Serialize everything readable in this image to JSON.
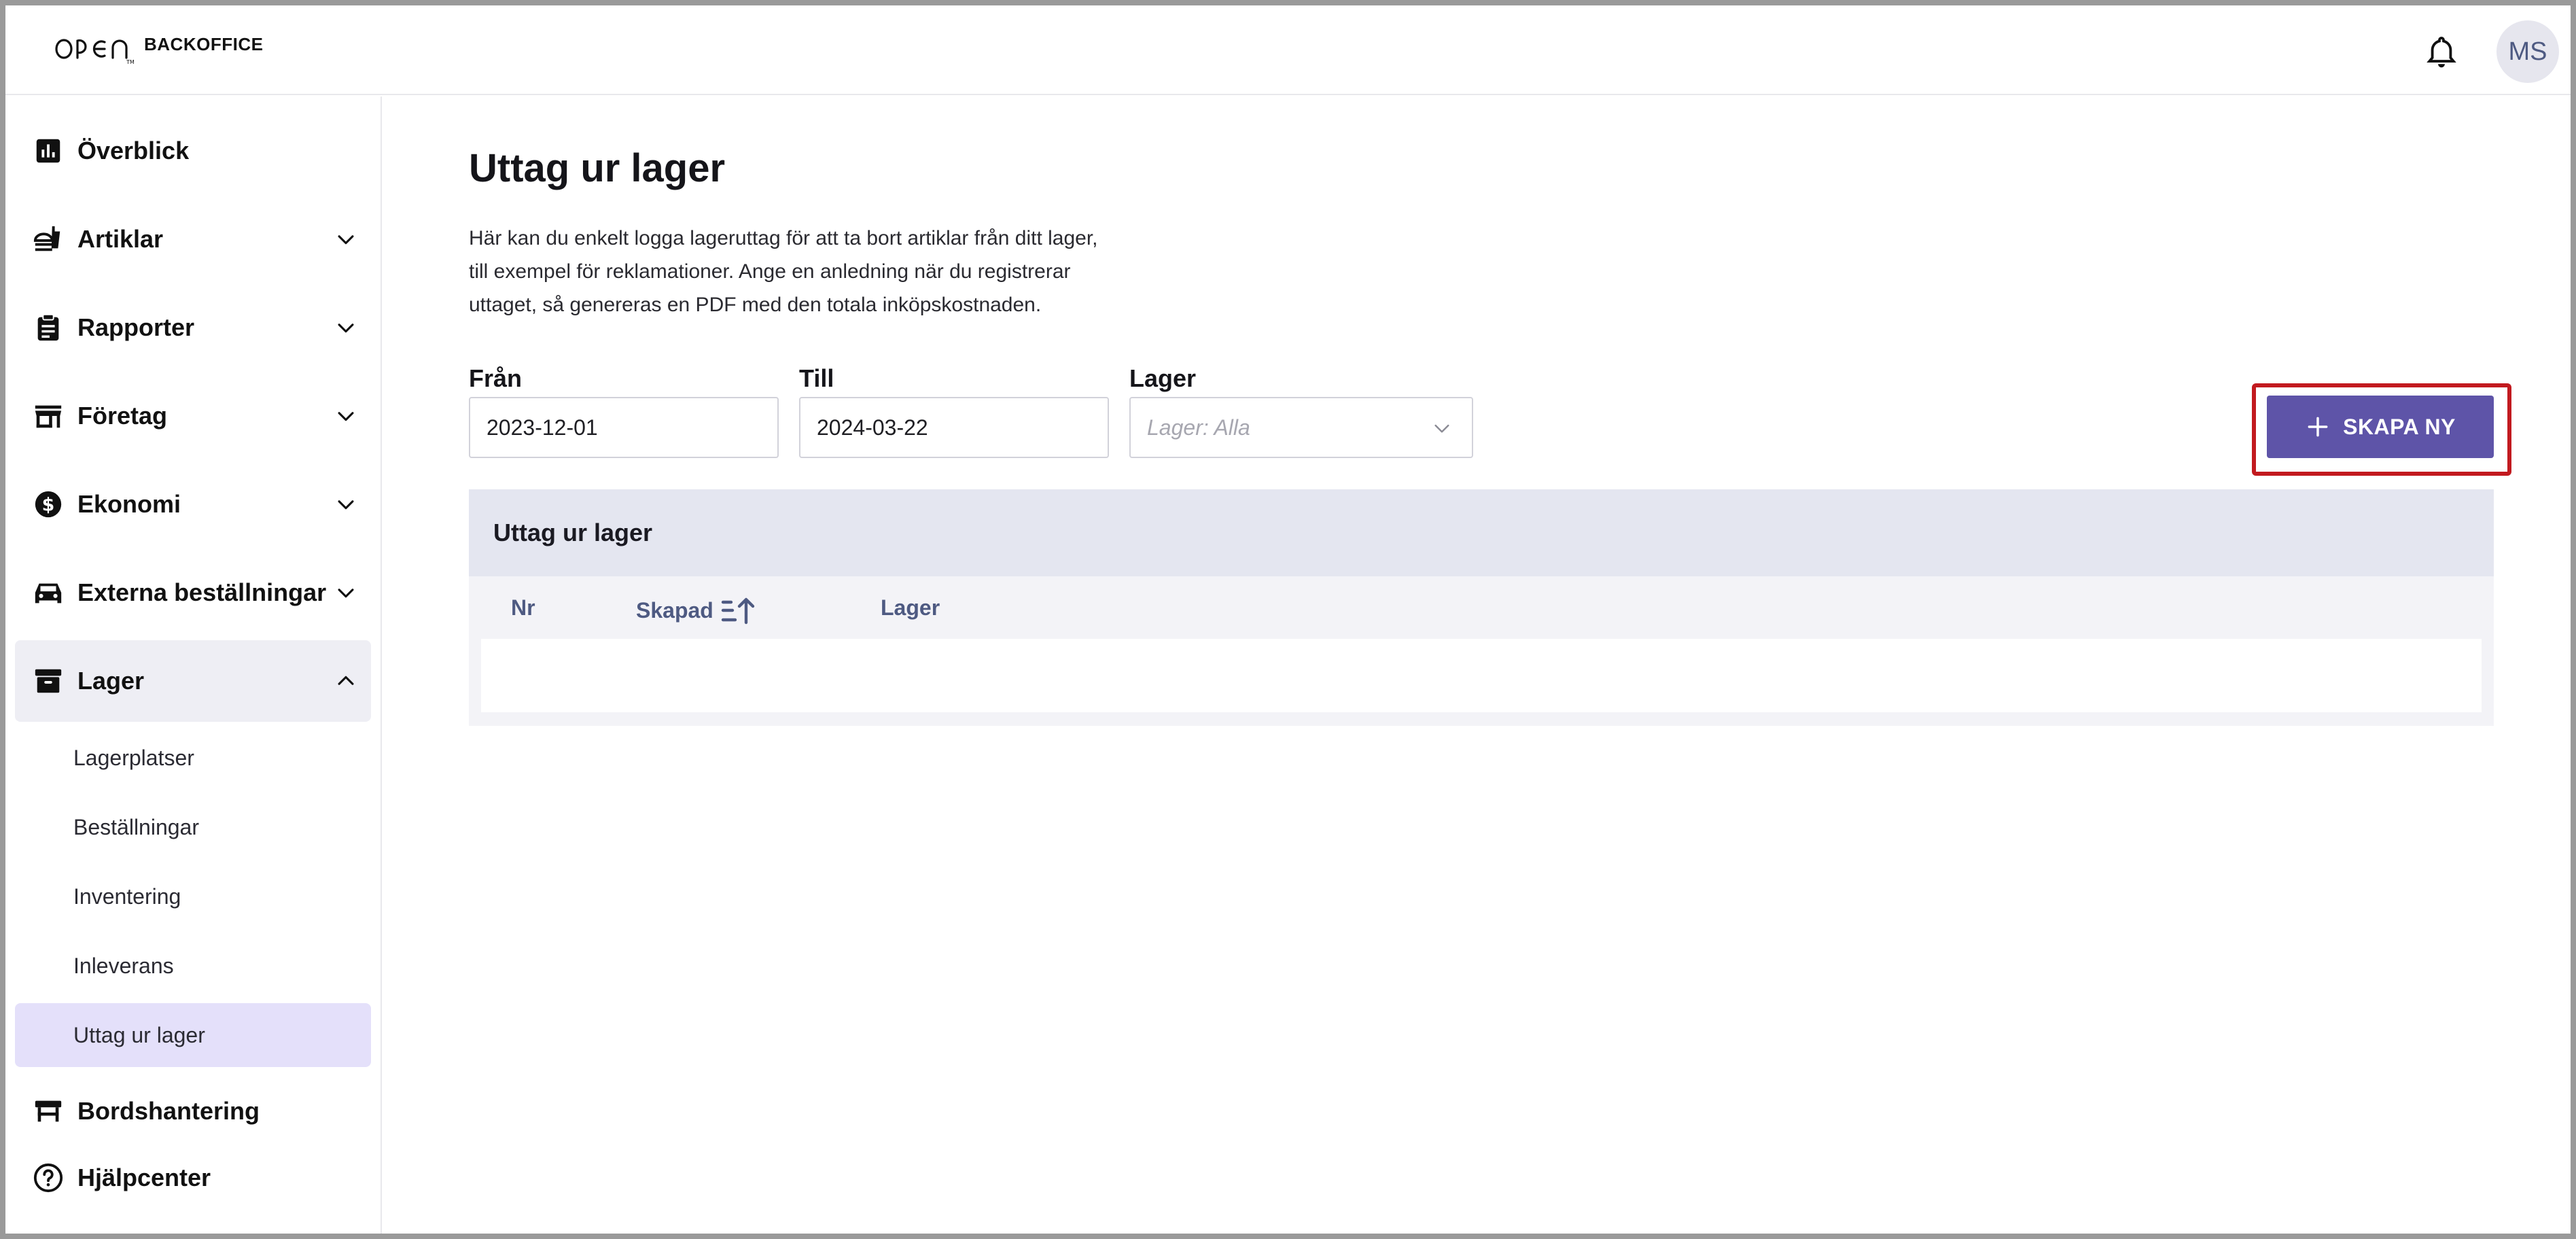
{
  "header": {
    "logo_mark": "OPEN",
    "logo_text": "BACKOFFICE",
    "avatar_initials": "MS"
  },
  "sidebar": {
    "items": [
      {
        "label": "Överblick",
        "icon": "bar-chart-icon",
        "expandable": false
      },
      {
        "label": "Artiklar",
        "icon": "fastfood-icon",
        "expandable": true
      },
      {
        "label": "Rapporter",
        "icon": "clipboard-icon",
        "expandable": true
      },
      {
        "label": "Företag",
        "icon": "store-icon",
        "expandable": true
      },
      {
        "label": "Ekonomi",
        "icon": "dollar-circle-icon",
        "expandable": true
      },
      {
        "label": "Externa beställningar",
        "icon": "car-icon",
        "expandable": true
      },
      {
        "label": "Lager",
        "icon": "archive-icon",
        "expandable": true,
        "expanded": true
      }
    ],
    "lager_sub_items": [
      {
        "label": "Lagerplatser"
      },
      {
        "label": "Beställningar"
      },
      {
        "label": "Inventering"
      },
      {
        "label": "Inleverans"
      },
      {
        "label": "Uttag ur lager",
        "selected": true
      }
    ],
    "bottom_items": [
      {
        "label": "Bordshantering",
        "icon": "table-icon"
      },
      {
        "label": "Hjälpcenter",
        "icon": "help-circle-icon"
      }
    ]
  },
  "main": {
    "title": "Uttag ur lager",
    "intro_lines": [
      "Här kan du enkelt logga lageruttag för att ta bort artiklar från ditt lager,",
      "till exempel för reklamationer. Ange en anledning när du registrerar",
      "uttaget, så genereras en PDF med den totala inköpskostnaden."
    ],
    "filters": {
      "from_label": "Från",
      "from_value": "2023-12-01",
      "to_label": "Till",
      "to_value": "2024-03-22",
      "warehouse_label": "Lager",
      "warehouse_placeholder": "Lager: Alla"
    },
    "create_button_label": "SKAPA NY",
    "table": {
      "title": "Uttag ur lager",
      "columns": [
        "Nr",
        "Skapad",
        "Lager"
      ]
    }
  },
  "colors": {
    "primary": "#5e54a8",
    "highlight": "#c21a1f",
    "selected_bg": "#e4e0fa",
    "column_text": "#4e5a82"
  }
}
